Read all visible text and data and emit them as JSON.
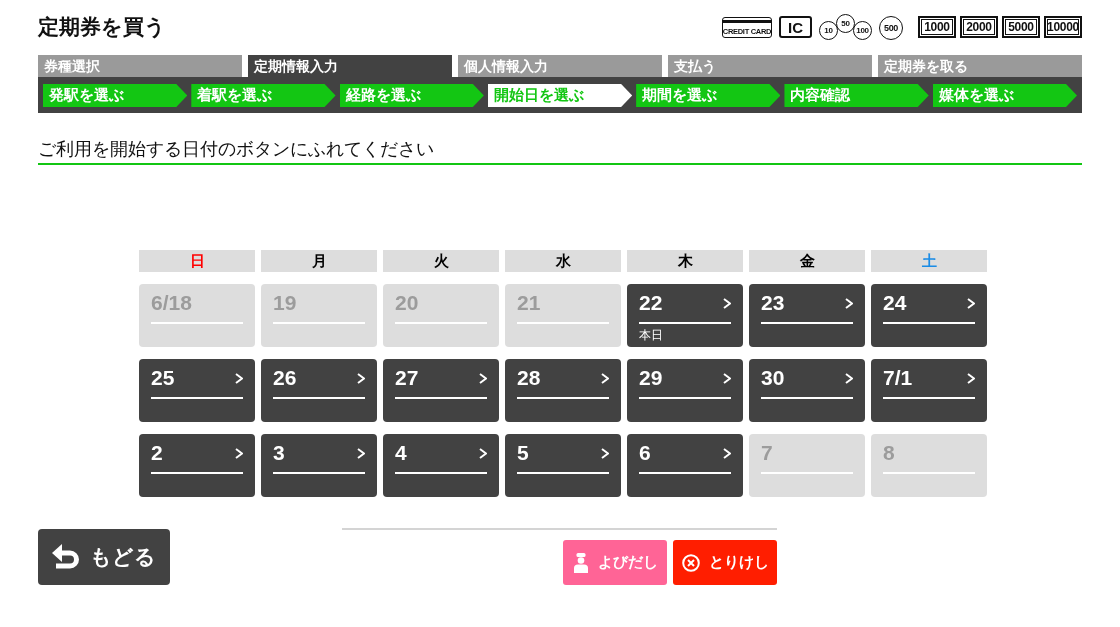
{
  "header": {
    "title": "定期券を買う",
    "payment_methods": [
      {
        "kind": "card",
        "label": "CREDIT CARD"
      },
      {
        "kind": "ic",
        "label": "IC"
      },
      {
        "kind": "coin_group",
        "labels": [
          "10",
          "50",
          "100"
        ]
      },
      {
        "kind": "coin",
        "label": "500"
      },
      {
        "kind": "note",
        "label": "1000"
      },
      {
        "kind": "note",
        "label": "2000"
      },
      {
        "kind": "note",
        "label": "5000"
      },
      {
        "kind": "note",
        "label": "10000"
      }
    ]
  },
  "stages": [
    {
      "label": "券種選択",
      "selected": false
    },
    {
      "label": "定期情報入力",
      "selected": true
    },
    {
      "label": "個人情報入力",
      "selected": false
    },
    {
      "label": "支払う",
      "selected": false
    },
    {
      "label": "定期券を取る",
      "selected": false
    }
  ],
  "steps": [
    {
      "label": "発駅を選ぶ",
      "selected": false
    },
    {
      "label": "着駅を選ぶ",
      "selected": false
    },
    {
      "label": "経路を選ぶ",
      "selected": false
    },
    {
      "label": "開始日を選ぶ",
      "selected": true
    },
    {
      "label": "期間を選ぶ",
      "selected": false
    },
    {
      "label": "内容確認",
      "selected": false
    },
    {
      "label": "媒体を選ぶ",
      "selected": false
    }
  ],
  "instruction": "ご利用を開始する日付のボタンにふれてください",
  "calendar": {
    "weekdays": [
      {
        "label": "日",
        "color": "#ff0000"
      },
      {
        "label": "月",
        "color": "#000000"
      },
      {
        "label": "火",
        "color": "#000000"
      },
      {
        "label": "水",
        "color": "#000000"
      },
      {
        "label": "木",
        "color": "#000000"
      },
      {
        "label": "金",
        "color": "#000000"
      },
      {
        "label": "土",
        "color": "#1a8ce6"
      }
    ],
    "weeks": [
      [
        {
          "date": "6/18",
          "disabled": true
        },
        {
          "date": "19",
          "disabled": true
        },
        {
          "date": "20",
          "disabled": true
        },
        {
          "date": "21",
          "disabled": true
        },
        {
          "date": "22",
          "disabled": false,
          "note": "本日"
        },
        {
          "date": "23",
          "disabled": false
        },
        {
          "date": "24",
          "disabled": false
        }
      ],
      [
        {
          "date": "25",
          "disabled": false
        },
        {
          "date": "26",
          "disabled": false
        },
        {
          "date": "27",
          "disabled": false
        },
        {
          "date": "28",
          "disabled": false
        },
        {
          "date": "29",
          "disabled": false
        },
        {
          "date": "30",
          "disabled": false
        },
        {
          "date": "7/1",
          "disabled": false
        }
      ],
      [
        {
          "date": "2",
          "disabled": false
        },
        {
          "date": "3",
          "disabled": false
        },
        {
          "date": "4",
          "disabled": false
        },
        {
          "date": "5",
          "disabled": false
        },
        {
          "date": "6",
          "disabled": false
        },
        {
          "date": "7",
          "disabled": true
        },
        {
          "date": "8",
          "disabled": true
        }
      ]
    ]
  },
  "footer": {
    "back_button": "もどる",
    "call_button": "よびだし",
    "cancel_button": "とりけし"
  }
}
